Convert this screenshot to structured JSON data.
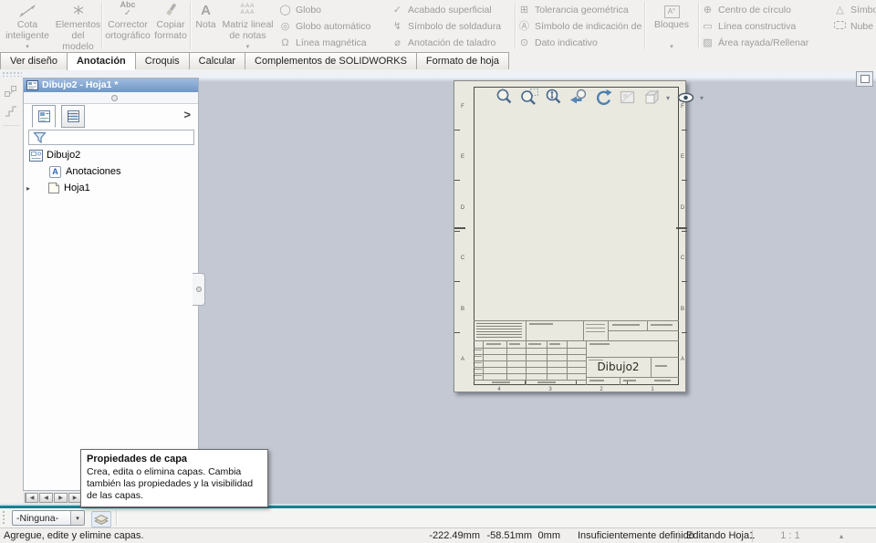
{
  "ribbon": {
    "big_buttons": [
      {
        "label": "Cota inteligente",
        "dropdown": true
      },
      {
        "label": "Elementos del modelo",
        "dropdown": false
      },
      {
        "label": "Corrector ortográfico",
        "dropdown": false
      },
      {
        "label": "Copiar formato",
        "dropdown": false
      },
      {
        "label": "Nota",
        "dropdown": false
      },
      {
        "label": "Matriz lineal de notas",
        "dropdown": true
      },
      {
        "label": "Bloques",
        "dropdown": true
      }
    ],
    "small_items": {
      "col1": [
        "Globo",
        "Globo automático",
        "Línea magnética"
      ],
      "col2": [
        "Acabado superficial",
        "Símbolo de soldadura",
        "Anotación de taladro"
      ],
      "col3": [
        "Tolerancia geométrica",
        "Símbolo de indicación de referencia",
        "Dato indicativo"
      ],
      "col4": [
        "Centro de círculo",
        "Línea constructiva",
        "Área rayada/Rellenar"
      ],
      "col5": [
        "Símbolo de re",
        "Nube de rev"
      ]
    }
  },
  "tabs": {
    "active": "Anotación",
    "items": [
      {
        "label": "Ver diseño"
      },
      {
        "label": "Anotación"
      },
      {
        "label": "Croquis"
      },
      {
        "label": "Calcular"
      },
      {
        "label": "Complementos de SOLIDWORKS"
      },
      {
        "label": "Formato de hoja"
      }
    ]
  },
  "feature_panel": {
    "title": "Dibujo2 - Hoja1 *",
    "tree": [
      {
        "label": "Dibujo2"
      },
      {
        "label": "Anotaciones"
      },
      {
        "label": "Hoja1"
      }
    ]
  },
  "drawing_sheet": {
    "title_block_name": "Dibujo2",
    "zone_rows": [
      "F",
      "E",
      "D",
      "C",
      "B",
      "A"
    ],
    "zone_cols": [
      "4",
      "3",
      "2",
      "1"
    ]
  },
  "tooltip": {
    "title": "Propiedades de capa",
    "body": "Crea, edita o elimina capas. Cambia también las propiedades y la visibilidad de las capas."
  },
  "layer_bar": {
    "selected_layer": "-Ninguna-"
  },
  "status_bar": {
    "message": "Agregue, edite y elimine capas.",
    "x": "-222.49mm",
    "y": "-58.51mm",
    "z": "0mm",
    "definition_state": "Insuficientemente definido",
    "mode": "Editando Hoja1",
    "scale": "1 : 1"
  },
  "icons": {
    "dropdown": "▾",
    "chevron": ">",
    "expander": "▸",
    "nota_glyph": "A",
    "abc_glyph": "Abc",
    "check_glyph": "✓",
    "matriz_glyph": "AAA",
    "bloques_glyph": "A°",
    "anotaciones_glyph": "A",
    "globo": "◯",
    "globo_automatico": "◎",
    "linea_magnetica": "Ω",
    "acabado": "✓",
    "soldadura": "↯",
    "taladro": "⌀",
    "tolerancia": "⊞",
    "indicacion": "Ⓐ",
    "dato": "⊙",
    "centro": "⊕",
    "constructiva": "▭",
    "rayada": "▨",
    "revision": "△",
    "nav_first": "◀",
    "nav_prev": "◀",
    "nav_next": "▶",
    "nav_last": "▶",
    "scale_arrow": "▴"
  },
  "colors": {
    "viewport_bg": "#c3c8d2",
    "sheet_bg": "#eae9e0",
    "panel_title_blue": "#6f97c6",
    "teal_border": "#19808f"
  }
}
